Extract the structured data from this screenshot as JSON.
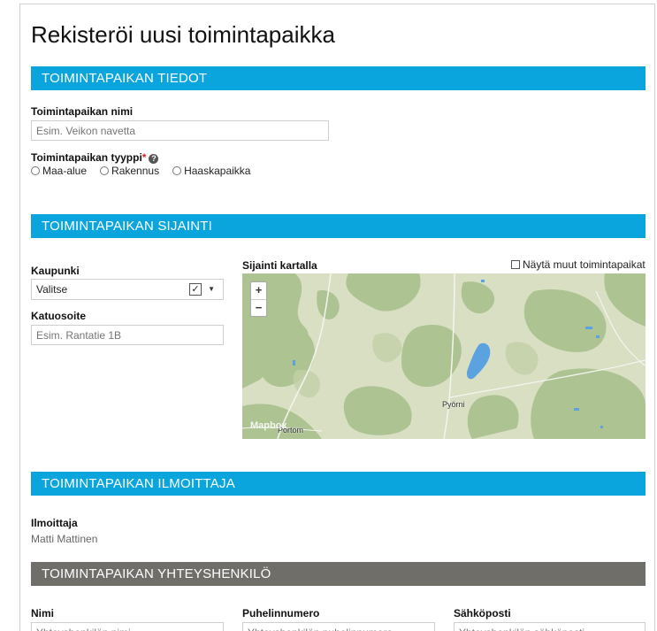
{
  "page": {
    "title": "Rekisteröi uusi toimintapaikka"
  },
  "sections": {
    "tiedot": "TOIMINTAPAIKAN TIEDOT",
    "sijainti": "TOIMINTAPAIKAN SIJAINTI",
    "ilmoittaja": "TOIMINTAPAIKAN ILMOITTAJA",
    "yhteyshenkilo": "TOIMINTAPAIKAN YHTEYSHENKILÖ"
  },
  "tiedot": {
    "name_label": "Toimintapaikan nimi",
    "name_placeholder": "Esim. Veikon navetta",
    "type_label": "Toimintapaikan tyyppi",
    "required_mark": "*",
    "help_icon": "?",
    "types": [
      "Maa-alue",
      "Rakennus",
      "Haaskapaikka"
    ]
  },
  "sijainti": {
    "city_label": "Kaupunki",
    "city_value": "Valitse",
    "address_label": "Katuosoite",
    "address_placeholder": "Esim. Rantatie 1B",
    "map_label": "Sijainti kartalla",
    "show_others_label": "Näytä muut toimintapaikat",
    "zoom_in": "+",
    "zoom_out": "−",
    "map_places": [
      "Pyörni",
      "Portom"
    ],
    "map_attribution": "Mapbox"
  },
  "ilmoittaja": {
    "label": "Ilmoittaja",
    "value": "Matti Mattinen"
  },
  "yhteyshenkilo": {
    "name_label": "Nimi",
    "name_placeholder": "Yhteyshenkilön nimi",
    "phone_label": "Puhelinnumero",
    "phone_placeholder": "Yhteyshenkilön puhelinnumero",
    "email_label": "Sähköposti",
    "email_placeholder": "Yhteyshenkilön sähköposti"
  },
  "colors": {
    "section_blue": "#0aa5dc",
    "section_gray": "#6f6e69"
  }
}
